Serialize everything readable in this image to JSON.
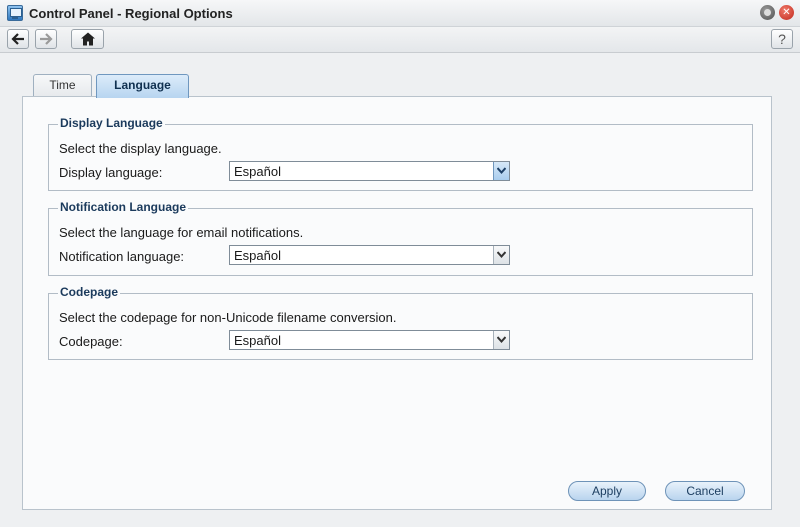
{
  "window": {
    "title": "Control Panel - Regional Options",
    "close_glyph": "✕"
  },
  "toolbar": {
    "help_label": "?"
  },
  "tabs": [
    {
      "label": "Time",
      "active": false
    },
    {
      "label": "Language",
      "active": true
    }
  ],
  "groups": [
    {
      "legend": "Display Language",
      "description": "Select the display language.",
      "field_label": "Display language:",
      "value": "Español"
    },
    {
      "legend": "Notification Language",
      "description": "Select the language for email notifications.",
      "field_label": "Notification language:",
      "value": "Español"
    },
    {
      "legend": "Codepage",
      "description": "Select the codepage for non-Unicode filename conversion.",
      "field_label": "Codepage:",
      "value": "Español"
    }
  ],
  "footer": {
    "apply_label": "Apply",
    "cancel_label": "Cancel"
  },
  "colors": {
    "accent": "#b7d5f0",
    "close": "#c0281c"
  }
}
